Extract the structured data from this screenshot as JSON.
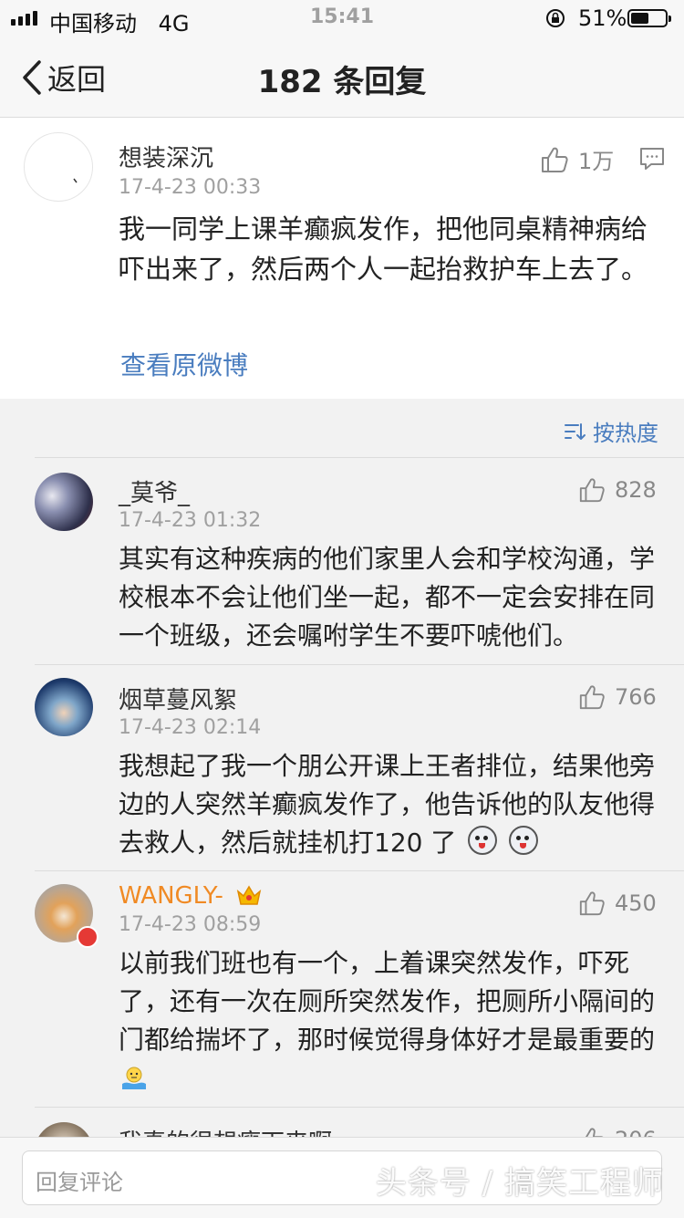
{
  "status_bar": {
    "carrier": "中国移动",
    "network": "4G",
    "time": "15:41",
    "battery": "51%"
  },
  "nav": {
    "back_label": "返回",
    "title": "182 条回复"
  },
  "post": {
    "user": "想装深沉",
    "time": "17-4-23 00:33",
    "likes": "1万",
    "text": "我一同学上课羊癫疯发作，把他同桌精神病给吓出来了，然后两个人一起抬救护车上去了。",
    "view_original": "查看原微博"
  },
  "sort": {
    "label": "按热度"
  },
  "comments": [
    {
      "user": "_莫爷_",
      "time": "17-4-23 01:32",
      "likes": "828",
      "text": "其实有这种疾病的他们家里人会和学校沟通，学校根本不会让他们坐一起，都不一定会安排在同一个班级，还会嘱咐学生不要吓唬他们。"
    },
    {
      "user": "烟草蔓风絮",
      "time": "17-4-23 02:14",
      "likes": "766",
      "text": "我想起了我一个朋公开课上王者排位，结果他旁边的人突然羊癫疯发作了，他告诉他的队友他得去救人，然后就挂机打120 了"
    },
    {
      "user": "WANGLY-",
      "time": "17-4-23 08:59",
      "likes": "450",
      "text": "以前我们班也有一个，上着课突然发作，吓死了，还有一次在厕所突然发作，把厕所小隔间的门都给揣坏了，那时候觉得身体好才是最重要的"
    },
    {
      "user": "我真的很想瘦下来啊",
      "likes": "206"
    }
  ],
  "reply_bar": {
    "placeholder": "回复评论"
  },
  "watermark": "头条号 / 搞笑工程师",
  "colors": {
    "link": "#4a7dbf",
    "vip_name": "#f08a24",
    "muted": "#a0a0a0"
  }
}
